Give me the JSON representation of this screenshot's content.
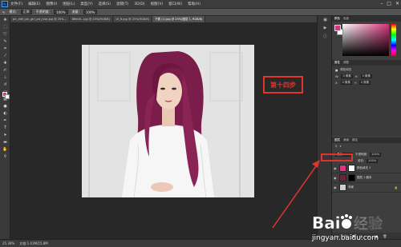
{
  "menubar": {
    "items": [
      "文件(F)",
      "编辑(E)",
      "图像(I)",
      "图层(L)",
      "类型(Y)",
      "选择(S)",
      "滤镜(T)",
      "3D(D)",
      "视图(V)",
      "窗口(W)",
      "帮助(H)"
    ],
    "window_controls": [
      "–",
      "□",
      "✕"
    ]
  },
  "optionbar": {
    "items": [
      "模式:",
      "正常",
      "不透明度:",
      "100%",
      "流量:",
      "100%"
    ]
  },
  "document_tabs": [
    "pic_edit_pic_girl_pic_lvse.jpg @ 25%...",
    "86e0d...jpg @ 25%(RGB/8)",
    "10_6.jpg @ 25%(RGB/8)",
    "下载 (1).jpg @ 25%(图层 1, RGB/8)"
  ],
  "annotation": {
    "step_label": "第十四步",
    "color": "#e2342b"
  },
  "statusbar": {
    "zoom": "25.39%",
    "doc_info": "文档:1.41M/15.8M"
  },
  "color_panel": {
    "tabs": [
      "颜色",
      "色板"
    ],
    "foreground": "#d4357c",
    "background": "#ffffff"
  },
  "properties": {
    "tabs": [
      "属性",
      "调整"
    ],
    "title": "颜色填充",
    "rows": [
      {
        "a": "W:",
        "b": "0 像素",
        "c": "H:",
        "d": "0 像素"
      },
      {
        "a": "X:",
        "b": "0 像素",
        "c": "Y:",
        "d": "0 像素"
      }
    ]
  },
  "layers": {
    "tabs": [
      "图层",
      "通道",
      "路径"
    ],
    "blend_mode": "叠加",
    "opacity_label": "不透明度:",
    "opacity": "100%",
    "fill_label": "填充:",
    "fill": "100%",
    "items": [
      {
        "name": "颜色填充 1",
        "thumb": "#e0357f",
        "mask": "#ffffff"
      },
      {
        "name": "图层 1 副本",
        "thumb": "#6b2440",
        "mask": "#000000"
      },
      {
        "name": "背景",
        "thumb": "#cfcfcf",
        "mask": ""
      }
    ]
  },
  "watermark": {
    "brand_left": "Bai",
    "brand_right": "经验",
    "url": "jingyan.baidu.com"
  }
}
